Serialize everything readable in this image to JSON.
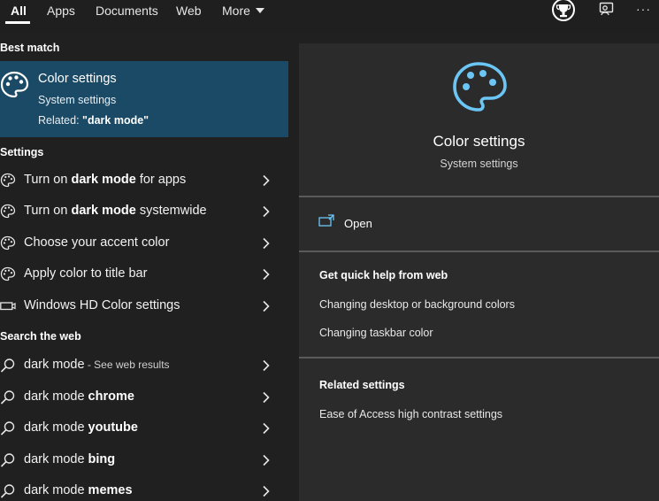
{
  "tabs": {
    "all": "All",
    "apps": "Apps",
    "documents": "Documents",
    "web": "Web",
    "more": "More"
  },
  "top_icons": [
    "rewards-trophy-icon",
    "feedback-icon",
    "more-options-icon"
  ],
  "top_icons_more_glyph": "···",
  "left": {
    "best_match_header": "Best match",
    "best_match": {
      "title": "Color settings",
      "subtitle": "System settings",
      "related_prefix": "Related: ",
      "related_term": "\"dark mode\""
    },
    "settings_header": "Settings",
    "settings_items": [
      {
        "pre": "Turn on ",
        "bold": "dark mode",
        "post": " for apps",
        "icon": "palette-icon"
      },
      {
        "pre": "Turn on ",
        "bold": "dark mode",
        "post": " systemwide",
        "icon": "palette-icon"
      },
      {
        "pre": "Choose your accent color",
        "bold": "",
        "post": "",
        "icon": "palette-icon"
      },
      {
        "pre": "Apply color to title bar",
        "bold": "",
        "post": "",
        "icon": "palette-icon"
      },
      {
        "pre": "Windows HD Color settings",
        "bold": "",
        "post": "",
        "icon": "display-icon"
      }
    ],
    "web_header": "Search the web",
    "web_items": [
      {
        "pre": "dark mode",
        "bold": "",
        "small": " - See web results"
      },
      {
        "pre": "dark mode ",
        "bold": "chrome",
        "small": ""
      },
      {
        "pre": "dark mode ",
        "bold": "youtube",
        "small": ""
      },
      {
        "pre": "dark mode ",
        "bold": "bing",
        "small": ""
      },
      {
        "pre": "dark mode ",
        "bold": "memes",
        "small": ""
      }
    ]
  },
  "right": {
    "title": "Color settings",
    "subtitle": "System settings",
    "open_label": "Open",
    "quick_help_header": "Get quick help from web",
    "quick_help_links": [
      "Changing desktop or background colors",
      "Changing taskbar color"
    ],
    "related_header": "Related settings",
    "related_links": [
      "Ease of Access high contrast settings"
    ]
  },
  "colors": {
    "accent": "#6cc6f5",
    "best_match_bg": "#1b4a66",
    "panel_bg": "#2b2b2b",
    "bg": "#202020"
  }
}
